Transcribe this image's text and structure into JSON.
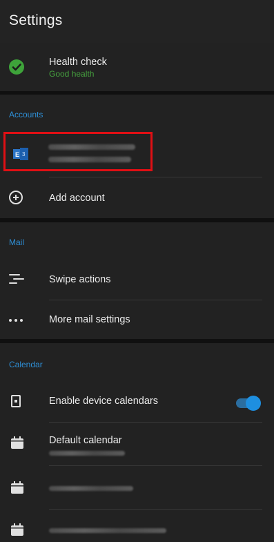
{
  "header": {
    "title": "Settings"
  },
  "health": {
    "title": "Health check",
    "status": "Good health",
    "status_color": "#46a23f"
  },
  "accounts": {
    "section_label": "Accounts",
    "account_icon": "exchange-icon",
    "add_account_label": "Add account"
  },
  "mail": {
    "section_label": "Mail",
    "items": [
      {
        "label": "Swipe actions",
        "icon": "swipe-actions-icon"
      },
      {
        "label": "More mail settings",
        "icon": "more-dots-icon"
      }
    ]
  },
  "calendar": {
    "section_label": "Calendar",
    "enable_device_calendars": {
      "label": "Enable device calendars",
      "enabled": true
    },
    "default_calendar": {
      "label": "Default calendar"
    }
  },
  "colors": {
    "accent": "#2e8fd6",
    "toggle_on": "#1e8fe0",
    "highlight_border": "#e10f14",
    "health_ok": "#3ea33a"
  }
}
